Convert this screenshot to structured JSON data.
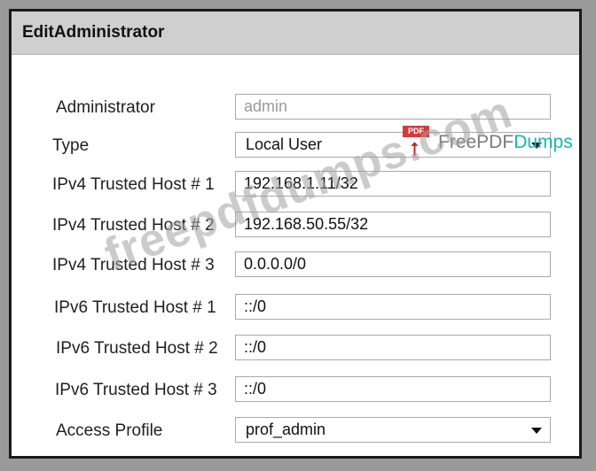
{
  "dialog": {
    "title": "EditAdministrator"
  },
  "form": {
    "administrator": {
      "label": "Administrator",
      "value": "admin"
    },
    "type": {
      "label": "Type",
      "value": "Local User"
    },
    "ipv4_host_1": {
      "label": "IPv4 Trusted Host # 1",
      "value": "192.168.1.11/32"
    },
    "ipv4_host_2": {
      "label": "IPv4 Trusted Host # 2",
      "value": "192.168.50.55/32"
    },
    "ipv4_host_3": {
      "label": "IPv4 Trusted Host # 3",
      "value": "0.0.0.0/0"
    },
    "ipv6_host_1": {
      "label": "IPv6 Trusted Host # 1",
      "value": "::/0"
    },
    "ipv6_host_2": {
      "label": "IPv6 Trusted Host # 2",
      "value": "::/0"
    },
    "ipv6_host_3": {
      "label": "IPv6 Trusted Host # 3",
      "value": "::/0"
    },
    "access_profile": {
      "label": "Access Profile",
      "value": "prof_admin"
    }
  },
  "watermarks": {
    "text": "freepdfdumps.com",
    "brand_free": "FreePDF",
    "brand_dumps": "Dumps",
    "pdf_tag": "PDF"
  }
}
